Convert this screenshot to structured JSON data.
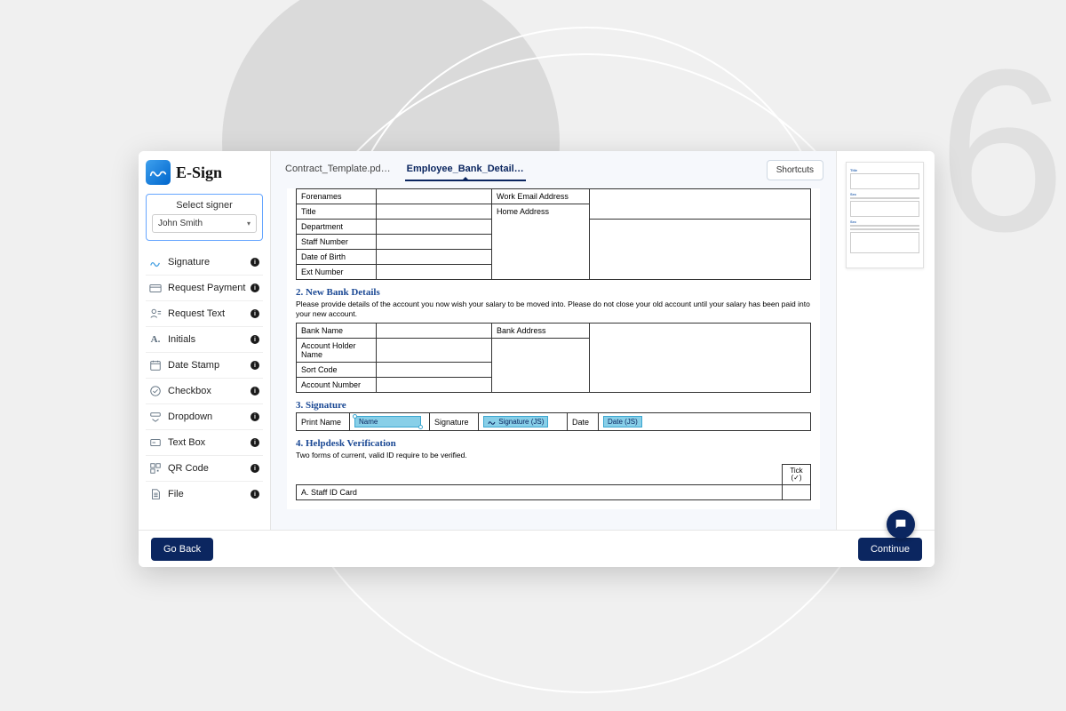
{
  "brand": {
    "name": "E-Sign"
  },
  "signer": {
    "label": "Select signer",
    "selected": "John Smith"
  },
  "tools": [
    {
      "label": "Signature"
    },
    {
      "label": "Request Payment"
    },
    {
      "label": "Request Text"
    },
    {
      "label": "Initials"
    },
    {
      "label": "Date Stamp"
    },
    {
      "label": "Checkbox"
    },
    {
      "label": "Dropdown"
    },
    {
      "label": "Text Box"
    },
    {
      "label": "QR Code"
    },
    {
      "label": "File"
    }
  ],
  "tabs": [
    {
      "label": "Contract_Template.pd…"
    },
    {
      "label": "Employee_Bank_Detail…"
    }
  ],
  "shortcuts_label": "Shortcuts",
  "doc": {
    "section1_rows_left": [
      "Forenames",
      "Title",
      "Department",
      "Staff Number",
      "Date of Birth",
      "Ext Number"
    ],
    "section1_rows_right": [
      "Work Email Address",
      "Home Address"
    ],
    "section2_title": "2. New Bank Details",
    "section2_desc": "Please provide details of the account you now wish your salary to be moved into.   Please do not close your old account until your salary has been paid into your new account.",
    "section2_rows_left": [
      "Bank Name",
      "Account Holder Name",
      "Sort Code",
      "Account Number"
    ],
    "section2_rows_right": [
      "Bank Address"
    ],
    "section3_title": "3. Signature",
    "sig_labels": {
      "print": "Print Name",
      "sig": "Signature",
      "date": "Date"
    },
    "sig_fields": {
      "name": "Name",
      "signature": "Signature (JS)",
      "date": "Date (JS)"
    },
    "section4_title": "4. Helpdesk Verification",
    "section4_desc": "Two forms of current, valid ID require to be verified.",
    "verify_tick": "Tick",
    "verify_check": "(✓)",
    "verify_row1": "A.   Staff ID Card"
  },
  "footer": {
    "back": "Go Back",
    "cont": "Continue"
  }
}
